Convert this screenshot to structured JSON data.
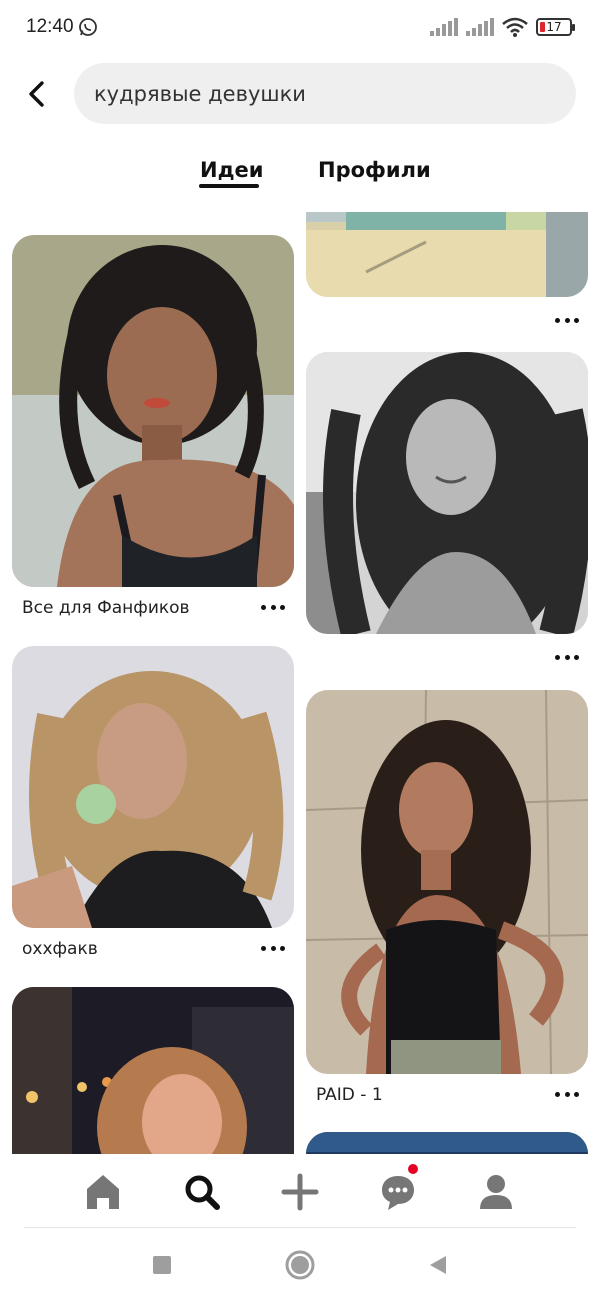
{
  "status": {
    "time": "12:40",
    "battery": "17",
    "icons": [
      "whatsapp-icon",
      "signal-icon",
      "signal-icon",
      "wifi-icon",
      "battery-icon"
    ]
  },
  "search": {
    "query": "кудрявые девушки",
    "back_icon": "chevron-left-icon"
  },
  "tabs": [
    {
      "label": "Идеи",
      "active": true
    },
    {
      "label": "Профили",
      "active": false
    }
  ],
  "pins": [
    {
      "label": "Все для Фанфиков"
    },
    {
      "label": "оххфакв"
    },
    {
      "label": ""
    },
    {
      "label": ""
    },
    {
      "label": ""
    },
    {
      "label": "PAID - 1"
    },
    {
      "label": ""
    }
  ],
  "nav": {
    "items": [
      "home-icon",
      "search-icon",
      "plus-icon",
      "messages-icon",
      "profile-icon"
    ],
    "notification_color": "#e60023"
  },
  "system_nav": [
    "recents-square-icon",
    "home-circle-icon",
    "back-triangle-icon"
  ]
}
